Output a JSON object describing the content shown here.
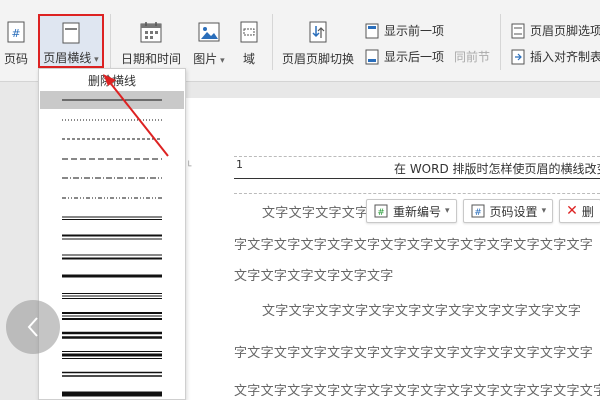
{
  "ribbon": {
    "page_number_partial": "页码",
    "header_line": "页眉横线",
    "date_time": "日期和时间",
    "picture": "图片",
    "field": "域",
    "switch_header_footer": "页眉页脚切换",
    "show_previous": "显示前一项",
    "show_next": "显示后一项",
    "same_as_previous": "同前节",
    "header_footer_options_partial": "页眉页脚选项",
    "insert_align_tab_partial": "插入对齐制表"
  },
  "dropdown": {
    "title": "删除横线",
    "styles": [
      "single",
      "dotted-fine",
      "dashed-fine",
      "dashed",
      "dash-dot",
      "dash-dot-fine",
      "double-thin",
      "thick-thin",
      "thin-thick",
      "thick",
      "triple",
      "thick-thin-thick",
      "double-thick",
      "thin-thick-thin",
      "double",
      "thick-bar"
    ]
  },
  "document": {
    "header_page_number": "1",
    "header_title": "在 WORD 排版时怎样使页眉的横线改变",
    "margin_mark": "└",
    "lines": [
      "文字文字文字文字",
      "字文字文字文字文字文字文字文字文字文字文字文字文字文字",
      "文字文字文字文字文字文字",
      "文字文字文字文字文字文字文字文字文字文字文字文字",
      "字文字文字文字文字文字文字文字文字文字文字文字文字文字",
      "文字文字文字文字文字文字文字文字文字文字文字文字文字文字"
    ]
  },
  "header_toolbar": {
    "renumber": "重新编号",
    "page_setup": "页码设置",
    "delete_partial": "删"
  },
  "colors": {
    "highlight_border": "#dd2222",
    "arrow": "#dd2222",
    "selected_item": "#c9c9c9"
  }
}
